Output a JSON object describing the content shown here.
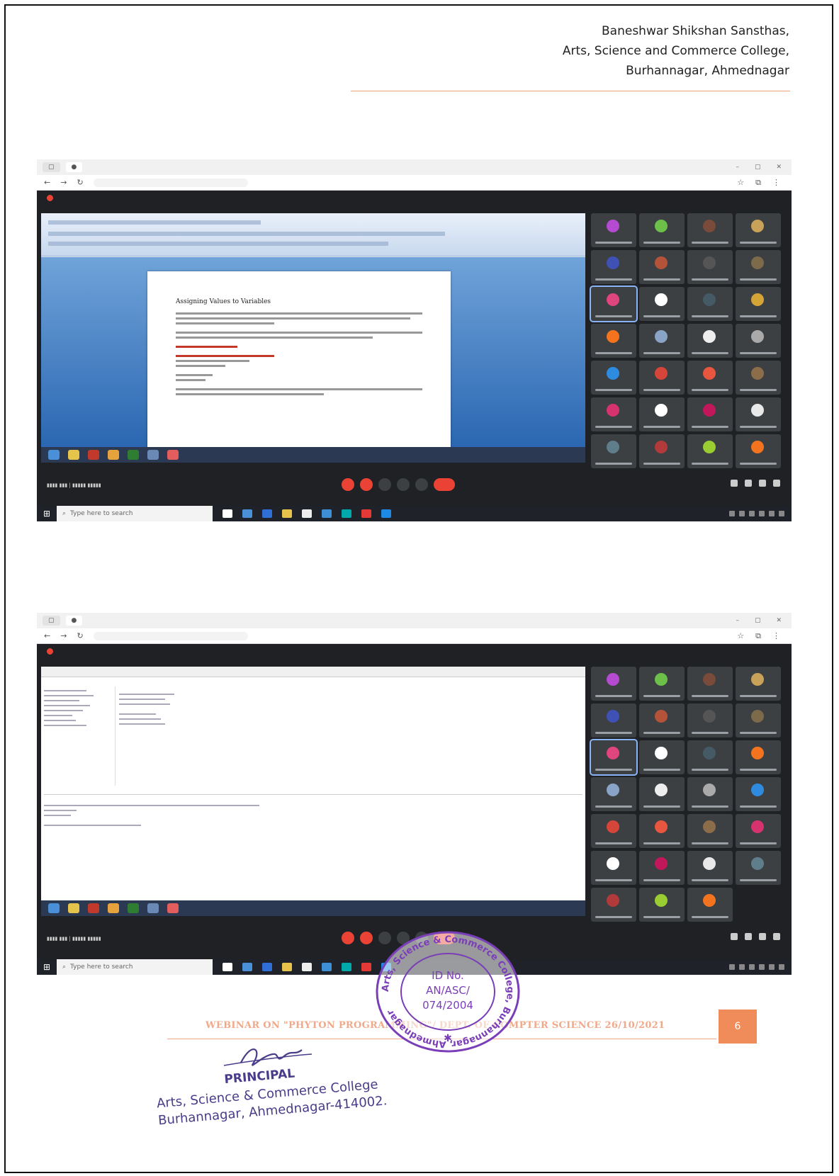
{
  "header": {
    "line1": "Baneshwar Shikshan Sansthas,",
    "line2": "Arts, Science and Commerce College,",
    "line3": "Burhannagar, Ahmednagar"
  },
  "taskbar": {
    "search_placeholder": "Type here to search"
  },
  "shared_doc": {
    "heading": "Assigning Values to Variables"
  },
  "footer": {
    "title": "WEBINAR ON \"PHYTON PROGRAMMING\"/ DEPT. OF COMPTER SCIENCE 26/10/2021",
    "page_number": "6"
  },
  "stamp": {
    "id_line1": "ID No.",
    "id_line2": "AN/ASC/",
    "id_line3": "074/2004",
    "ring_text": "Arts, Science & Commerce College, Burhannagar, Ahmednagar"
  },
  "signature": {
    "title": "PRINCIPAL",
    "line1": "Arts, Science & Commerce College",
    "line2": "Burhannagar, Ahmednagar-414002."
  },
  "colors": {
    "accent": "#f08c5a",
    "stamp": "#7a3fb8",
    "meet_bg": "#202124"
  }
}
